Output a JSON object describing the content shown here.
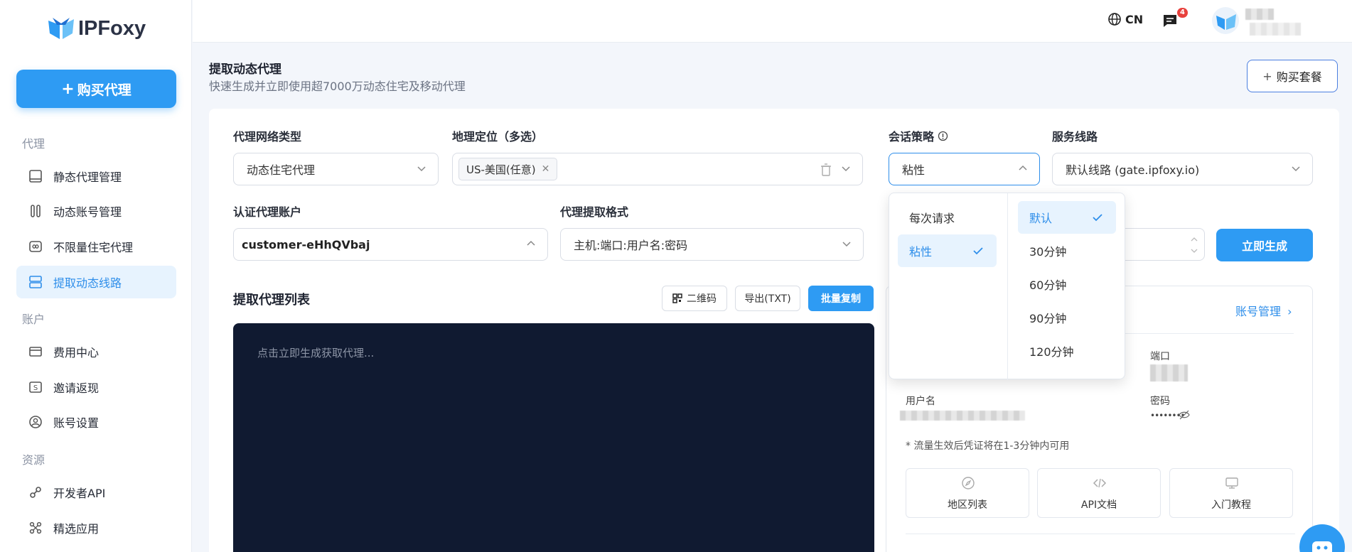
{
  "brand": {
    "name": "IPFoxy"
  },
  "sidebar": {
    "buy_label": "购买代理",
    "sections": {
      "proxy": "代理",
      "account": "账户",
      "resources": "资源"
    },
    "items": [
      {
        "label": "静态代理管理",
        "icon": "monitor-icon"
      },
      {
        "label": "动态账号管理",
        "icon": "sliders-icon"
      },
      {
        "label": "不限量住宅代理",
        "icon": "infinity-icon"
      },
      {
        "label": "提取动态线路",
        "icon": "server-icon"
      },
      {
        "label": "费用中心",
        "icon": "credit-card-icon"
      },
      {
        "label": "邀请返现",
        "icon": "dollar-icon"
      },
      {
        "label": "账号设置",
        "icon": "user-icon"
      },
      {
        "label": "开发者API",
        "icon": "link-icon"
      },
      {
        "label": "精选应用",
        "icon": "apps-icon"
      }
    ]
  },
  "header": {
    "lang": "CN",
    "msg_count": "4"
  },
  "page": {
    "title": "提取动态代理",
    "subtitle": "快速生成并立即使用超7000万动态住宅及移动代理",
    "buy_package": "购买套餐"
  },
  "form": {
    "network_type_label": "代理网络类型",
    "network_type_value": "动态住宅代理",
    "geo_label": "地理定位（多选）",
    "geo_tag": "US-美国(任意)",
    "session_label": "会话策略",
    "session_value": "粘性",
    "route_label": "服务线路",
    "route_value": "默认线路 (gate.ipfoxy.io)",
    "auth_label": "认证代理账户",
    "auth_value": "customer-eHhQVbaj",
    "format_label": "代理提取格式",
    "format_value": "主机:端口:用户名:密码",
    "generate": "立即生成"
  },
  "list": {
    "title": "提取代理列表",
    "qr": "二维码",
    "export": "导出(TXT)",
    "copy": "批量复制",
    "placeholder": "点击立即生成获取代理..."
  },
  "account": {
    "manage": "账号管理",
    "port": "端口",
    "username": "用户名",
    "password": "密码",
    "password_mask": "••••••••",
    "note": "* 流量生效后凭证将在1-3分钟内可用",
    "tiles": [
      "地区列表",
      "API文档",
      "入门教程"
    ]
  },
  "session_dropdown": {
    "modes": [
      {
        "label": "每次请求",
        "selected": false
      },
      {
        "label": "粘性",
        "selected": true
      }
    ],
    "durations": [
      {
        "label": "默认",
        "selected": true
      },
      {
        "label": "30分钟",
        "selected": false
      },
      {
        "label": "60分钟",
        "selected": false
      },
      {
        "label": "90分钟",
        "selected": false
      },
      {
        "label": "120分钟",
        "selected": false
      }
    ]
  },
  "colors": {
    "primary": "#2e9bf3",
    "link": "#2e8eea",
    "console": "#101a31",
    "badge": "#e8413d"
  }
}
